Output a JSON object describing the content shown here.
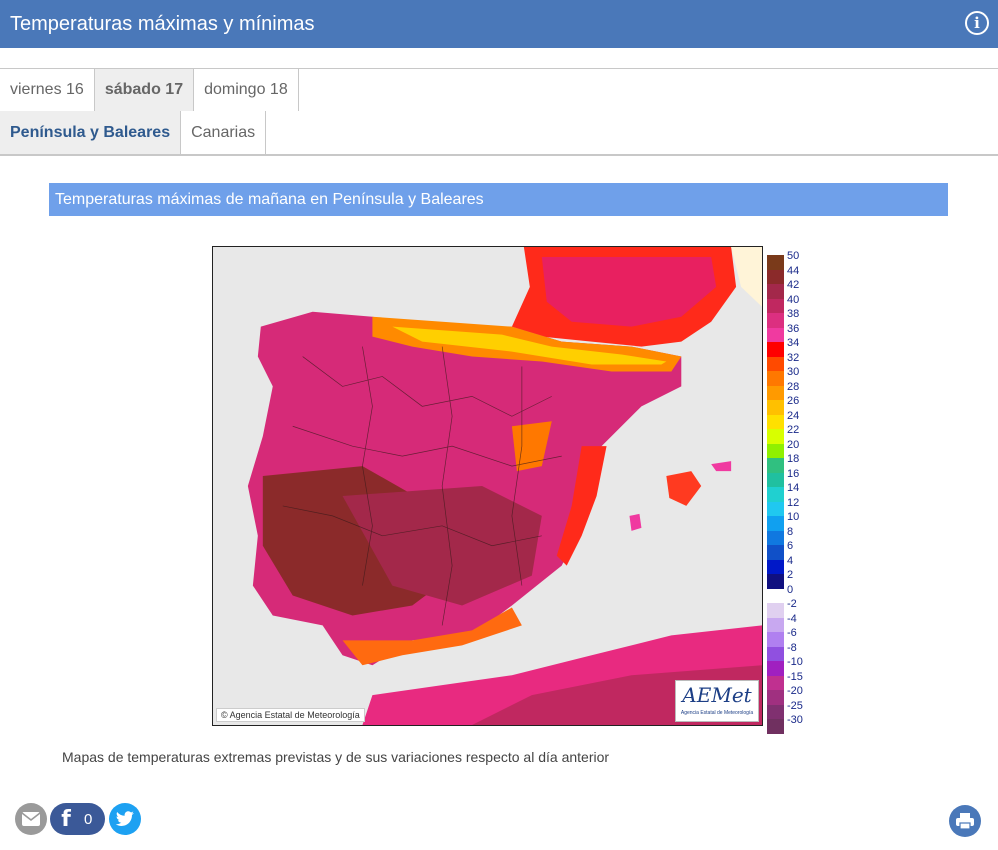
{
  "header": {
    "title": "Temperaturas máximas y mínimas"
  },
  "day_tabs": [
    {
      "label": "viernes 16"
    },
    {
      "label": "sábado 17"
    },
    {
      "label": "domingo 18"
    }
  ],
  "region_tabs": [
    {
      "label": "Península y Baleares"
    },
    {
      "label": "Canarias"
    }
  ],
  "section": {
    "title": "Temperaturas máximas de mañana en Península y Baleares"
  },
  "map": {
    "copyright": "Agencia Estatal de Meteorología",
    "logo_text": "AEMet",
    "logo_subtext": "Agencia Estatal de Meteorología"
  },
  "legend": [
    {
      "label": "50",
      "color": "#7a3a1a"
    },
    {
      "label": "44",
      "color": "#8b2a2a"
    },
    {
      "label": "42",
      "color": "#a3284a"
    },
    {
      "label": "40",
      "color": "#c02860"
    },
    {
      "label": "38",
      "color": "#dc2f80"
    },
    {
      "label": "36",
      "color": "#f03aa0"
    },
    {
      "label": "34",
      "color": "#ff0000"
    },
    {
      "label": "32",
      "color": "#ff4a00"
    },
    {
      "label": "30",
      "color": "#ff7800"
    },
    {
      "label": "28",
      "color": "#ff9a00"
    },
    {
      "label": "26",
      "color": "#ffc000"
    },
    {
      "label": "24",
      "color": "#ffe000"
    },
    {
      "label": "22",
      "color": "#d8ff00"
    },
    {
      "label": "20",
      "color": "#90f000"
    },
    {
      "label": "18",
      "color": "#30c080"
    },
    {
      "label": "16",
      "color": "#20c0a0"
    },
    {
      "label": "14",
      "color": "#20d0d0"
    },
    {
      "label": "12",
      "color": "#20c8f0"
    },
    {
      "label": "10",
      "color": "#10a0f0"
    },
    {
      "label": "8",
      "color": "#1078e0"
    },
    {
      "label": "6",
      "color": "#1050c8"
    },
    {
      "label": "4",
      "color": "#0018c8"
    },
    {
      "label": "2",
      "color": "#101080"
    },
    {
      "label": "0",
      "color": "#ffffff"
    },
    {
      "label": "-2",
      "color": "#e0d0f0"
    },
    {
      "label": "-4",
      "color": "#c8a8f0"
    },
    {
      "label": "-6",
      "color": "#b080f0"
    },
    {
      "label": "-8",
      "color": "#9050e0"
    },
    {
      "label": "-10",
      "color": "#a020c0"
    },
    {
      "label": "-15",
      "color": "#c03090"
    },
    {
      "label": "-20",
      "color": "#a03080"
    },
    {
      "label": "-25",
      "color": "#803070"
    },
    {
      "label": "-30",
      "color": "#703060"
    }
  ],
  "caption": "Mapas de temperaturas extremas previstas y de sus variaciones respecto al día anterior",
  "social": {
    "fb_count": "0"
  },
  "icons": {
    "info": "info-icon",
    "email": "email-icon",
    "facebook": "facebook-icon",
    "twitter": "twitter-icon",
    "print": "print-icon"
  }
}
